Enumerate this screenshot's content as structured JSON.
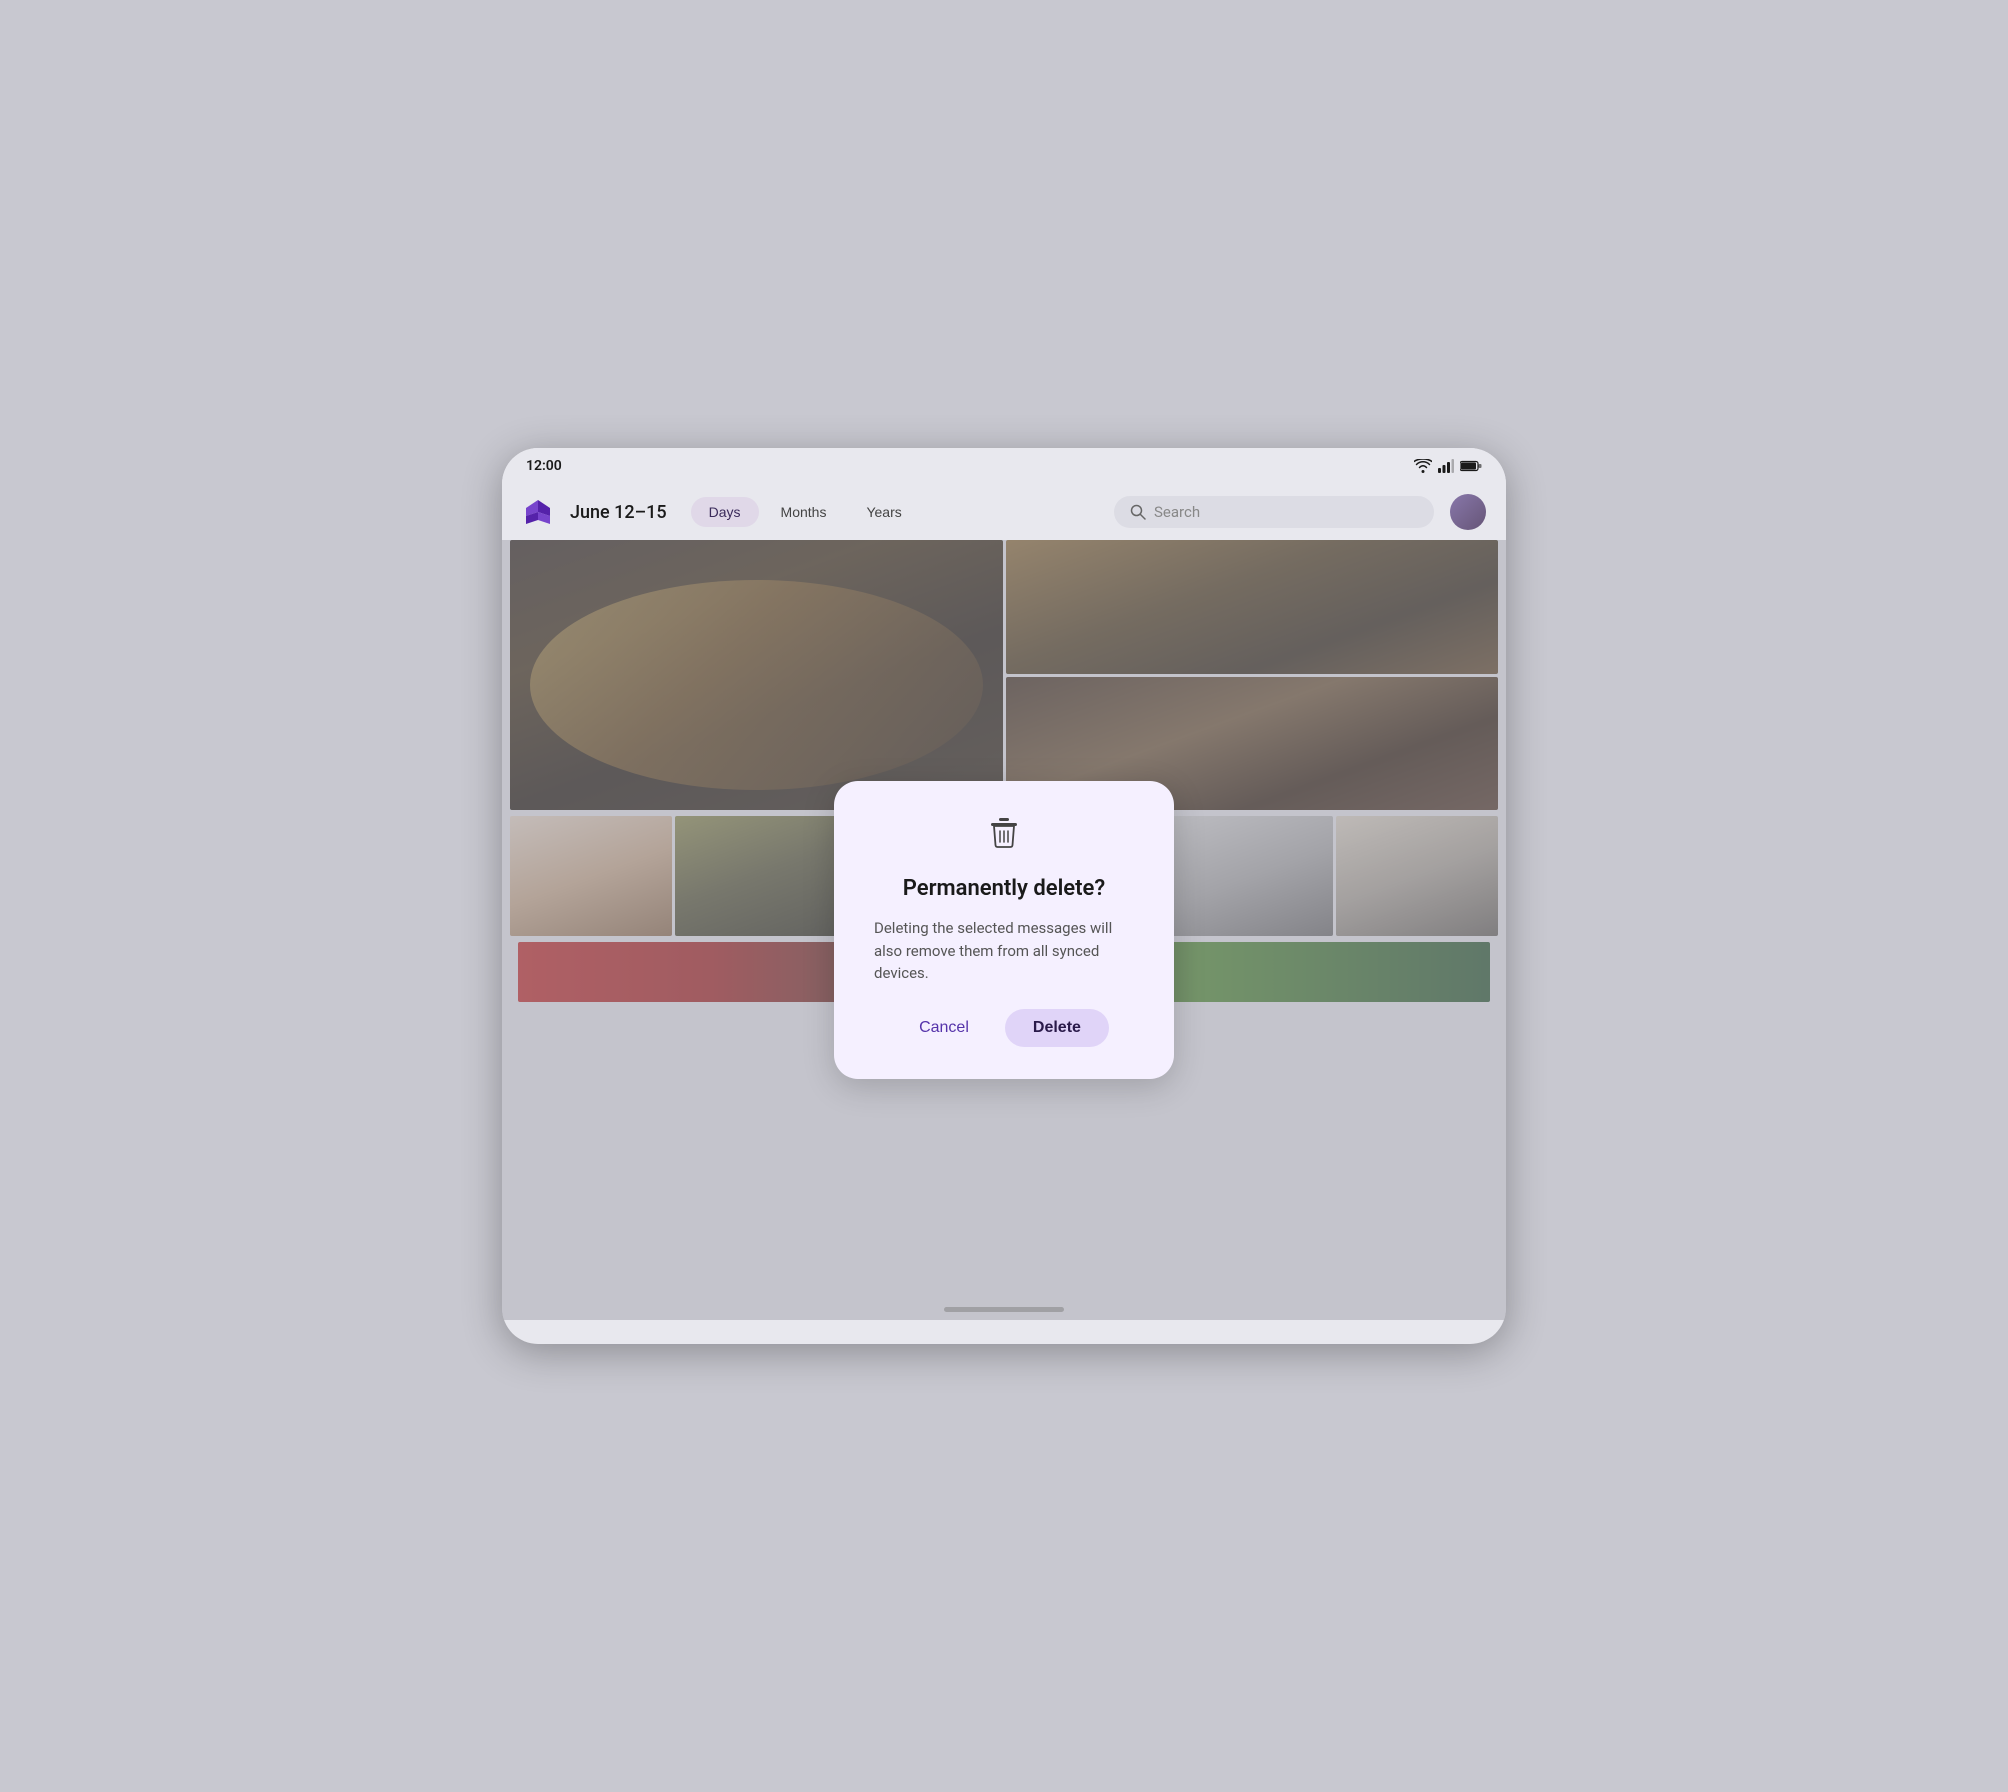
{
  "statusBar": {
    "time": "12:00"
  },
  "navBar": {
    "dateRange": "June 12–15",
    "tabs": [
      {
        "label": "Days",
        "active": true
      },
      {
        "label": "Months",
        "active": false
      },
      {
        "label": "Years",
        "active": false
      }
    ],
    "search": {
      "placeholder": "Search"
    }
  },
  "dialog": {
    "title": "Permanently delete?",
    "message": "Deleting the selected messages will also remove them from all synced devices.",
    "cancelLabel": "Cancel",
    "deleteLabel": "Delete"
  },
  "homeIndicator": ""
}
